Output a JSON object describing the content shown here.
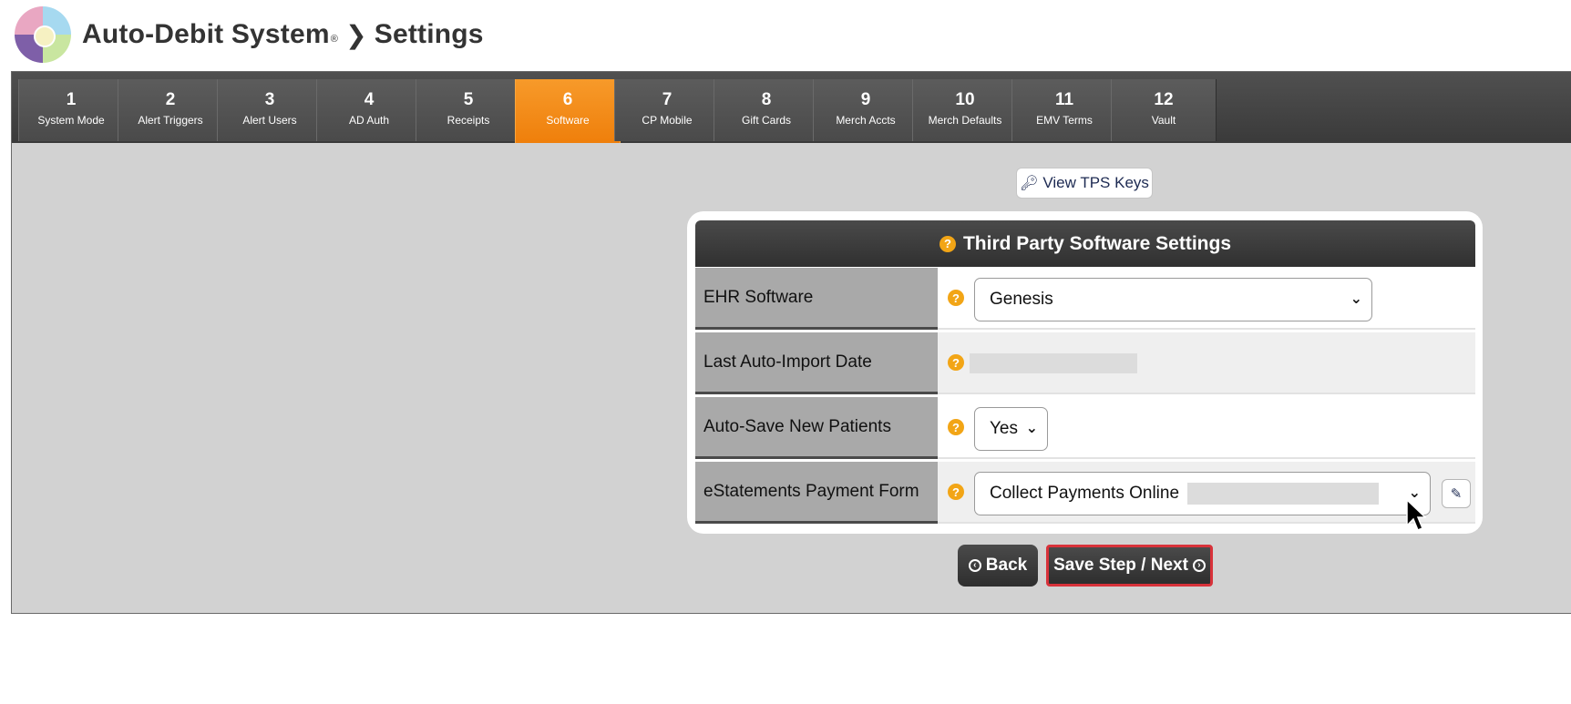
{
  "header": {
    "app_title": "Auto-Debit System",
    "registered_mark": "®",
    "separator": "❯",
    "page_title": "Settings"
  },
  "tabs": [
    {
      "num": "1",
      "label": "System Mode"
    },
    {
      "num": "2",
      "label": "Alert Triggers"
    },
    {
      "num": "3",
      "label": "Alert Users"
    },
    {
      "num": "4",
      "label": "AD Auth"
    },
    {
      "num": "5",
      "label": "Receipts"
    },
    {
      "num": "6",
      "label": "Software",
      "active": true
    },
    {
      "num": "7",
      "label": "CP Mobile"
    },
    {
      "num": "8",
      "label": "Gift Cards"
    },
    {
      "num": "9",
      "label": "Merch Accts"
    },
    {
      "num": "10",
      "label": "Merch Defaults"
    },
    {
      "num": "11",
      "label": "EMV Terms"
    },
    {
      "num": "12",
      "label": "Vault"
    }
  ],
  "tps_button": {
    "label": "View TPS Keys",
    "icon": "key-icon"
  },
  "card": {
    "title": "Third Party Software Settings",
    "rows": [
      {
        "label": "EHR Software",
        "value": "Genesis"
      },
      {
        "label": "Last Auto-Import Date",
        "value": ""
      },
      {
        "label": "Auto-Save New Patients",
        "value": "Yes"
      },
      {
        "label": "eStatements Payment Form",
        "value": "Collect Payments Online"
      }
    ]
  },
  "buttons": {
    "back": "Back",
    "save": "Save Step / Next"
  },
  "colors": {
    "active_tab": "#f0820f",
    "help_icon": "#f2a516",
    "highlight_border": "#d8323a"
  }
}
